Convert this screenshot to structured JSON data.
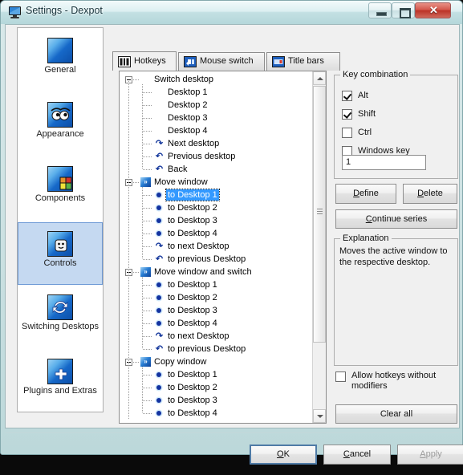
{
  "window": {
    "title": "Settings - Dexpot",
    "icon": "monitor-icon",
    "minimize_label": "–",
    "maximize_label": "□",
    "close_label": "✕"
  },
  "sidebar": {
    "items": [
      {
        "label": "General",
        "icon": "general-icon",
        "selected": false
      },
      {
        "label": "Appearance",
        "icon": "eyes-icon",
        "selected": false
      },
      {
        "label": "Components",
        "icon": "blocks-icon",
        "selected": false
      },
      {
        "label": "Controls",
        "icon": "face-icon",
        "selected": true
      },
      {
        "label": "Switching Desktops",
        "icon": "refresh-icon",
        "selected": false
      },
      {
        "label": "Plugins and Extras",
        "icon": "plus-icon",
        "selected": false
      }
    ]
  },
  "tabs": [
    {
      "label": "Hotkeys",
      "icon": "hotkeys-icon",
      "active": true
    },
    {
      "label": "Mouse switch",
      "icon": "mouse-switch-icon",
      "active": false
    },
    {
      "label": "Title bars",
      "icon": "title-bars-icon",
      "active": false
    }
  ],
  "tree": {
    "groups": [
      {
        "label": "Switch desktop",
        "icon": "arrow-desktop-icon",
        "expanded": true,
        "children": [
          {
            "label": "Desktop 1",
            "icon": "arrow-desktop-icon"
          },
          {
            "label": "Desktop 2",
            "icon": "arrow-desktop-icon"
          },
          {
            "label": "Desktop 3",
            "icon": "arrow-desktop-icon"
          },
          {
            "label": "Desktop 4",
            "icon": "arrow-desktop-icon"
          },
          {
            "label": "Next desktop",
            "icon": "redo-arrow-icon"
          },
          {
            "label": "Previous desktop",
            "icon": "undo-arrow-icon"
          },
          {
            "label": "Back",
            "icon": "undo-arrow-icon"
          }
        ]
      },
      {
        "label": "Move window",
        "icon": "move-window-icon",
        "expanded": true,
        "children": [
          {
            "label": "to Desktop 1",
            "icon": "window-move-icon",
            "selected": true
          },
          {
            "label": "to Desktop 2",
            "icon": "window-move-icon"
          },
          {
            "label": "to Desktop 3",
            "icon": "window-move-icon"
          },
          {
            "label": "to Desktop 4",
            "icon": "window-move-icon"
          },
          {
            "label": "to next Desktop",
            "icon": "redo-arrow-icon"
          },
          {
            "label": "to previous Desktop",
            "icon": "undo-arrow-icon"
          }
        ]
      },
      {
        "label": "Move window and switch",
        "icon": "move-window-icon",
        "expanded": true,
        "children": [
          {
            "label": "to Desktop 1",
            "icon": "window-move-icon"
          },
          {
            "label": "to Desktop 2",
            "icon": "window-move-icon"
          },
          {
            "label": "to Desktop 3",
            "icon": "window-move-icon"
          },
          {
            "label": "to Desktop 4",
            "icon": "window-move-icon"
          },
          {
            "label": "to next Desktop",
            "icon": "redo-arrow-icon"
          },
          {
            "label": "to previous Desktop",
            "icon": "undo-arrow-icon"
          }
        ]
      },
      {
        "label": "Copy window",
        "icon": "move-window-icon",
        "expanded": true,
        "children": [
          {
            "label": "to Desktop 1",
            "icon": "window-move-icon"
          },
          {
            "label": "to Desktop 2",
            "icon": "window-move-icon"
          },
          {
            "label": "to Desktop 3",
            "icon": "window-move-icon"
          },
          {
            "label": "to Desktop 4",
            "icon": "window-move-icon"
          }
        ]
      }
    ]
  },
  "key_combination": {
    "title": "Key combination",
    "checkboxes": [
      {
        "label": "Alt",
        "checked": true
      },
      {
        "label": "Shift",
        "checked": true
      },
      {
        "label": "Ctrl",
        "checked": false
      },
      {
        "label": "Windows key",
        "checked": false
      }
    ],
    "key_value": "1",
    "key_placeholder": ""
  },
  "actions": {
    "define": {
      "pre": "D",
      "mnemonic": "",
      "text": "efine"
    },
    "define_label": "Define",
    "delete_label": "Delete",
    "continue_label": "Continue series",
    "clear_all_label": "Clear all"
  },
  "explanation": {
    "title": "Explanation",
    "text": "Moves the active window to the respective desktop."
  },
  "allow_hotkeys": {
    "label": "Allow hotkeys without modifiers",
    "checked": false
  },
  "footer": {
    "ok_label": "OK",
    "cancel_label": "Cancel",
    "apply_label": "Apply",
    "apply_disabled": true
  },
  "colors": {
    "selection_blue": "#3399ff",
    "sidebar_selected": "#c5d9f1",
    "titlebar": "#c3e0e3",
    "dialog_bg": "#f0f0f0"
  }
}
